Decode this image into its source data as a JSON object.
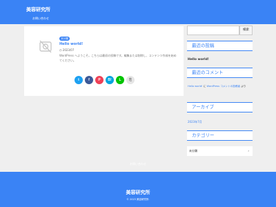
{
  "header": {
    "site_title": "美容研究所",
    "nav_link": "お問い合わせ"
  },
  "post": {
    "category": "未分類",
    "title": "Hello world!",
    "date": "2023/07",
    "excerpt": "WordPress へようこそ。こちらは最初の投稿です。編集または削除し、コンテンツ作成を始めてください。",
    "thumb_icon": "no-image-icon"
  },
  "share": [
    {
      "name": "twitter",
      "glyph": "t",
      "color": "#1da1f2"
    },
    {
      "name": "facebook",
      "glyph": "f",
      "color": "#3b5998"
    },
    {
      "name": "pocket",
      "glyph": "P",
      "color": "#ef4056"
    },
    {
      "name": "hatena",
      "glyph": "B!",
      "color": "#00a4de"
    },
    {
      "name": "line",
      "glyph": "L",
      "color": "#00c300"
    },
    {
      "name": "copy",
      "glyph": "⎘",
      "color": "#e6e6e6"
    }
  ],
  "sidebar": {
    "search_button": "検索",
    "recent_posts_title": "最近の投稿",
    "recent_post_item": "Hello world!",
    "recent_comments_title": "最近のコメント",
    "comment_author": "Hello world!",
    "comment_mid": " に ",
    "comment_link": "WordPress コメントの投稿者",
    "comment_suffix": " より",
    "archive_title": "アーカイブ",
    "archive_item": "2023年7月",
    "category_title": "カテゴリー",
    "category_item": "未分類",
    "category_chevron": "›"
  },
  "footer": {
    "link": "お問い合わせ",
    "title": "美容研究所",
    "copyright": "© 2023 美容研究所."
  },
  "colors": {
    "accent": "#3a83f5",
    "background": "#efefef"
  }
}
